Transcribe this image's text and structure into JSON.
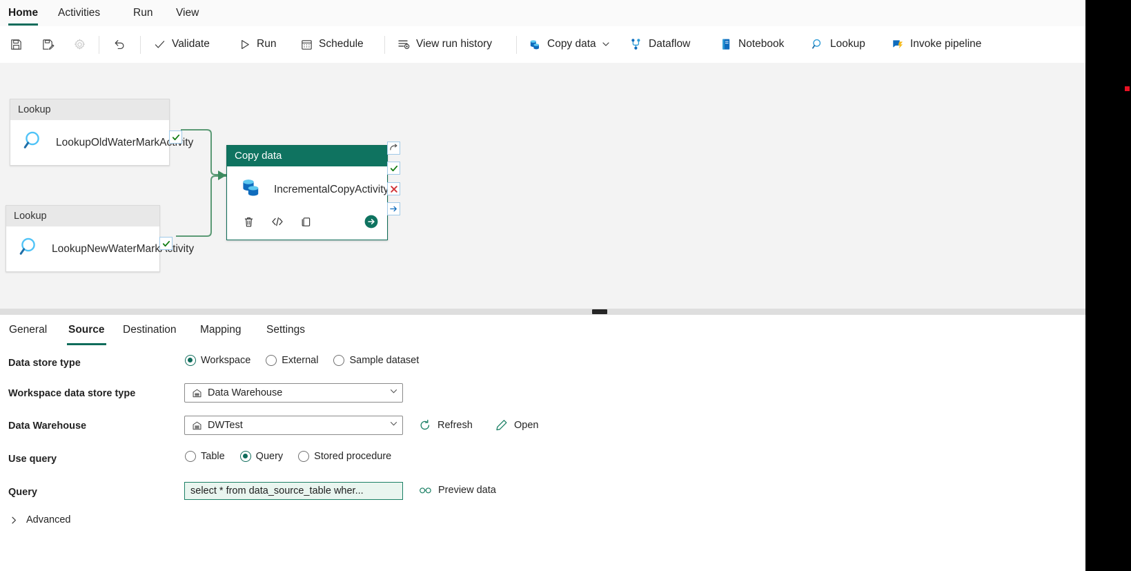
{
  "ribbon": {
    "tabs": [
      {
        "label": "Home",
        "active": true
      },
      {
        "label": "Activities",
        "active": false
      },
      {
        "label": "Run",
        "active": false
      },
      {
        "label": "View",
        "active": false
      }
    ]
  },
  "toolbar": {
    "save_label": "",
    "save_as_label": "",
    "settings_label": "",
    "undo_label": "",
    "validate_label": "Validate",
    "run_label": "Run",
    "schedule_label": "Schedule",
    "view_run_history_label": "View run history",
    "copy_data_label": "Copy data",
    "dataflow_label": "Dataflow",
    "notebook_label": "Notebook",
    "lookup_label": "Lookup",
    "invoke_pipeline_label": "Invoke pipeline"
  },
  "canvas": {
    "nodes": [
      {
        "type_label": "Lookup",
        "name": "LookupOldWaterMarkActivity",
        "icon": "magnifier-icon"
      },
      {
        "type_label": "Lookup",
        "name": "LookupNewWaterMarkActivity",
        "icon": "magnifier-icon"
      },
      {
        "type_label": "Copy data",
        "name": "IncrementalCopyActivity",
        "icon": "database-copy-icon"
      }
    ],
    "copy_actions": [
      "delete-icon",
      "code-icon",
      "clone-icon",
      "run-arrow-icon"
    ],
    "handles": [
      "skip-icon",
      "success-check-icon",
      "failure-x-icon",
      "completion-arrow-icon"
    ]
  },
  "properties": {
    "tabs": [
      {
        "label": "General",
        "active": false
      },
      {
        "label": "Source",
        "active": true
      },
      {
        "label": "Destination",
        "active": false
      },
      {
        "label": "Mapping",
        "active": false
      },
      {
        "label": "Settings",
        "active": false
      }
    ]
  },
  "form": {
    "data_store_type": {
      "label": "Data store type",
      "options": [
        "Workspace",
        "External",
        "Sample dataset"
      ],
      "selected": "Workspace"
    },
    "workspace_data_store_type": {
      "label": "Workspace data store type",
      "value": "Data Warehouse",
      "icon": "warehouse-icon"
    },
    "data_warehouse": {
      "label": "Data Warehouse",
      "value": "DWTest",
      "icon": "warehouse-icon",
      "refresh_label": "Refresh",
      "open_label": "Open"
    },
    "use_query": {
      "label": "Use query",
      "options": [
        "Table",
        "Query",
        "Stored procedure"
      ],
      "selected": "Query"
    },
    "query": {
      "label": "Query",
      "value": "select * from data_source_table wher...",
      "preview_label": "Preview data"
    },
    "advanced": {
      "label": "Advanced",
      "expanded": false
    }
  },
  "colors": {
    "accent": "#0f6c5b",
    "copy_node_header": "#0f7360",
    "success": "#107c10",
    "failure": "#d13438",
    "completion": "#0f6cbd",
    "query_field_bg": "#e9f5ef"
  }
}
